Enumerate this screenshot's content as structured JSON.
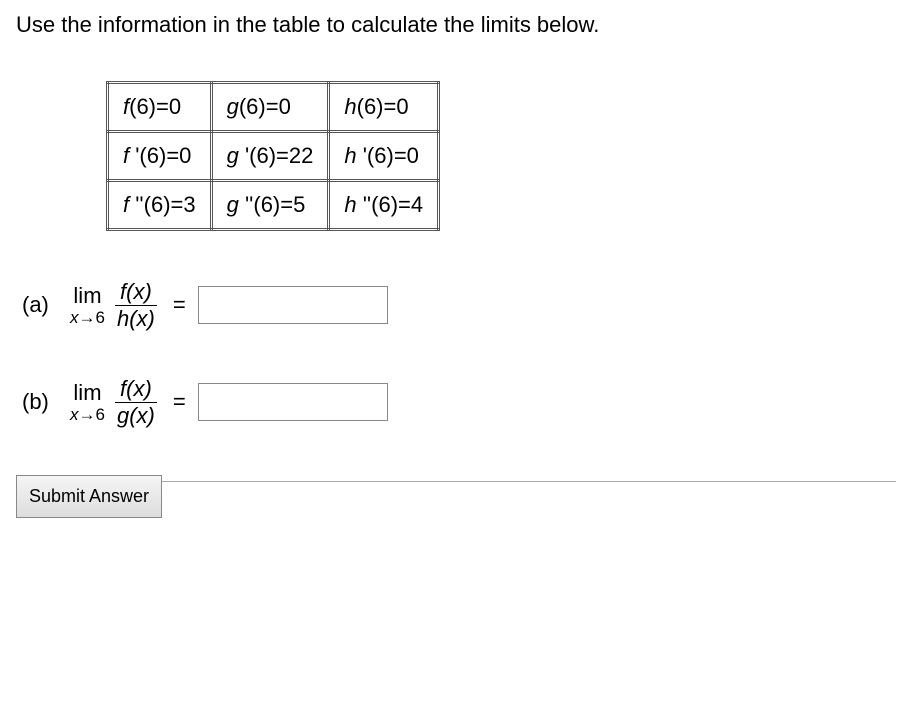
{
  "prompt": "Use the information in the table to calculate the limits below.",
  "table": {
    "r1": {
      "c1_fn": "f",
      "c1_val": "(6)=0",
      "c2_fn": "g",
      "c2_val": "(6)=0",
      "c3_fn": "h",
      "c3_val": "(6)=0"
    },
    "r2": {
      "c1_fn": "f ",
      "c1_val": "'(6)=0",
      "c2_fn": "g ",
      "c2_val": "'(6)=22",
      "c3_fn": "h ",
      "c3_val": "'(6)=0"
    },
    "r3": {
      "c1_fn": "f ",
      "c1_val": "''(6)=3",
      "c2_fn": "g ",
      "c2_val": "''(6)=5",
      "c3_fn": "h ",
      "c3_val": "''(6)=4"
    }
  },
  "questions": {
    "a": {
      "label": "(a)",
      "lim_word": "lim",
      "lim_sub_var": "x",
      "lim_sub_arrow": "→",
      "lim_sub_val": "6",
      "num": "f(x)",
      "den": "h(x)",
      "equals": "=",
      "answer": ""
    },
    "b": {
      "label": "(b)",
      "lim_word": "lim",
      "lim_sub_var": "x",
      "lim_sub_arrow": "→",
      "lim_sub_val": "6",
      "num": "f(x)",
      "den": "g(x)",
      "equals": "=",
      "answer": ""
    }
  },
  "submit_label": "Submit Answer"
}
